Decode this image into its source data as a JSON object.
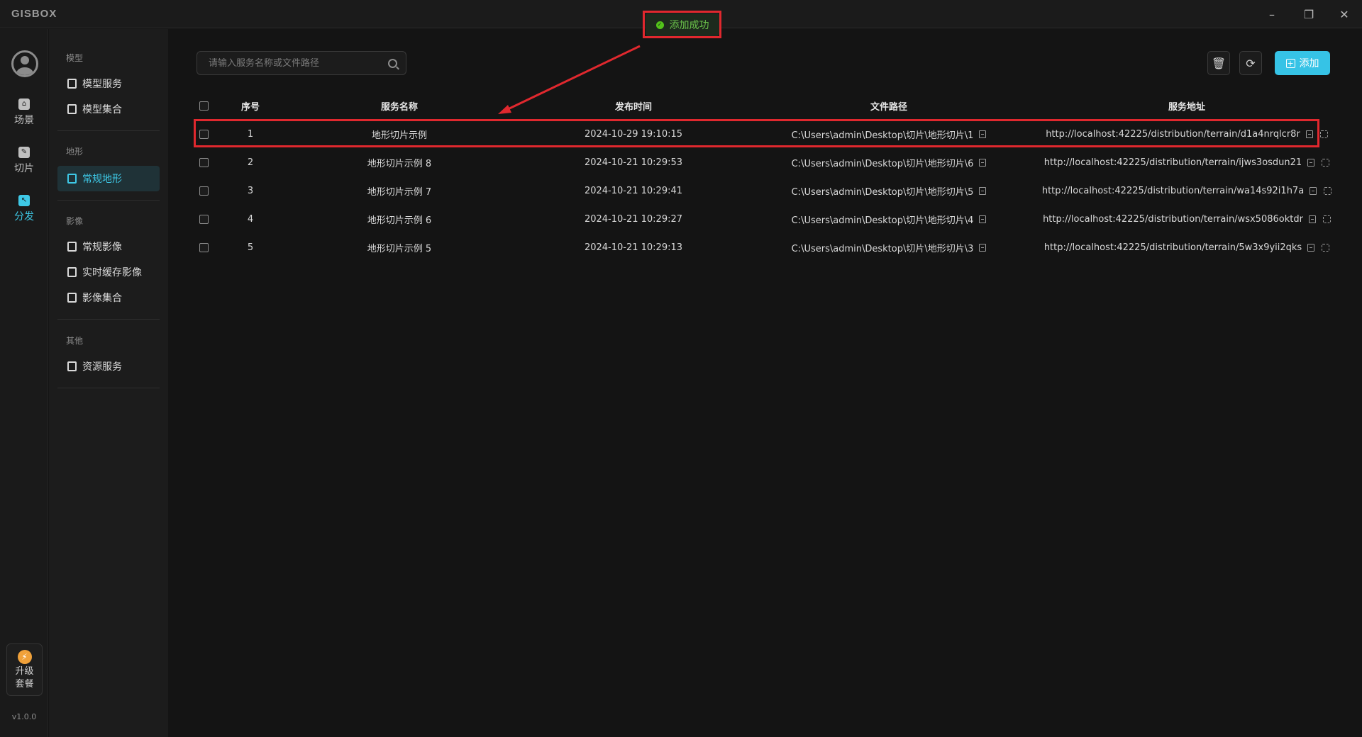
{
  "app": {
    "logo": "GISBOX",
    "window_controls": {
      "minimize": "–",
      "maximize": "❐",
      "close": "✕"
    }
  },
  "toast": {
    "message": "添加成功",
    "icon": "check-circle-icon",
    "color": "#52c41a"
  },
  "rail": {
    "items": [
      {
        "label": "场景",
        "icon": "home-icon"
      },
      {
        "label": "切片",
        "icon": "edit-icon"
      },
      {
        "label": "分发",
        "icon": "share-icon",
        "active": true
      }
    ],
    "upgrade": {
      "line1": "升级",
      "line2": "套餐",
      "icon": "bolt-icon"
    },
    "version": "v1.0.0"
  },
  "submenu": {
    "sections": [
      {
        "heading": "模型",
        "items": [
          "模型服务",
          "模型集合"
        ]
      },
      {
        "heading": "地形",
        "items": [
          "常规地形"
        ]
      },
      {
        "heading": "影像",
        "items": [
          "常规影像",
          "实时缓存影像",
          "影像集合"
        ]
      },
      {
        "heading": "其他",
        "items": [
          "资源服务"
        ]
      }
    ],
    "active_item": "常规地形"
  },
  "toolbar": {
    "search_placeholder": "请输入服务名称或文件路径",
    "search_value": "",
    "add_label": "添加",
    "accent": "#36c3e6"
  },
  "table": {
    "headers": [
      "序号",
      "服务名称",
      "发布时间",
      "文件路径",
      "服务地址"
    ],
    "rows": [
      {
        "idx": "1",
        "name": "地形切片示例",
        "time": "2024-10-29 19:10:15",
        "path": "C:\\Users\\admin\\Desktop\\切片\\地形切片\\1",
        "url": "http://localhost:42225/distribution/terrain/d1a4nrqlcr8r"
      },
      {
        "idx": "2",
        "name": "地形切片示例 8",
        "time": "2024-10-21 10:29:53",
        "path": "C:\\Users\\admin\\Desktop\\切片\\地形切片\\6",
        "url": "http://localhost:42225/distribution/terrain/ijws3osdun21"
      },
      {
        "idx": "3",
        "name": "地形切片示例 7",
        "time": "2024-10-21 10:29:41",
        "path": "C:\\Users\\admin\\Desktop\\切片\\地形切片\\5",
        "url": "http://localhost:42225/distribution/terrain/wa14s92i1h7a"
      },
      {
        "idx": "4",
        "name": "地形切片示例 6",
        "time": "2024-10-21 10:29:27",
        "path": "C:\\Users\\admin\\Desktop\\切片\\地形切片\\4",
        "url": "http://localhost:42225/distribution/terrain/wsx5086oktdr"
      },
      {
        "idx": "5",
        "name": "地形切片示例 5",
        "time": "2024-10-21 10:29:13",
        "path": "C:\\Users\\admin\\Desktop\\切片\\地形切片\\3",
        "url": "http://localhost:42225/distribution/terrain/5w3x9yii2qks"
      }
    ]
  },
  "annotation": {
    "color": "#e0282e"
  }
}
